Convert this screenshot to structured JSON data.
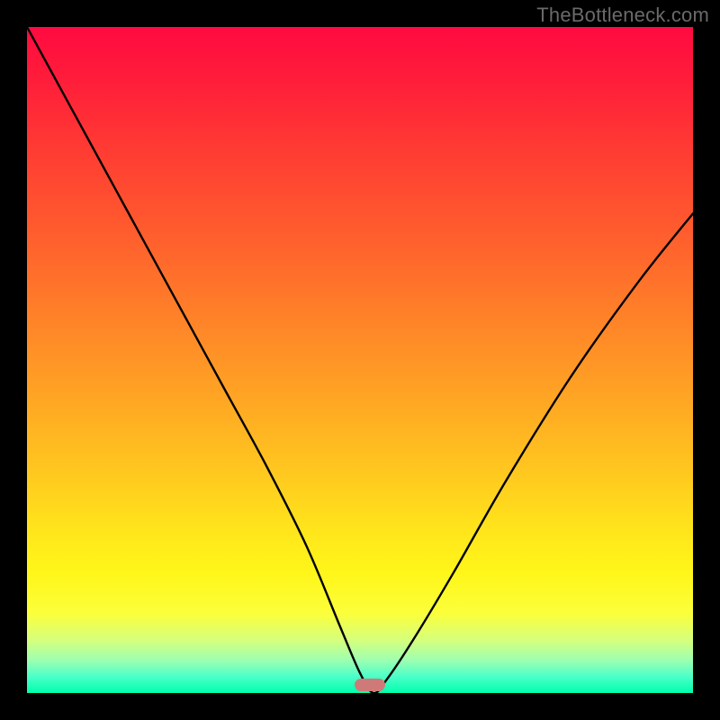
{
  "watermark": "TheBottleneck.com",
  "chart_data": {
    "type": "line",
    "title": "",
    "xlabel": "",
    "ylabel": "",
    "xlim": [
      0,
      100
    ],
    "ylim": [
      0,
      100
    ],
    "grid": false,
    "legend": false,
    "background_gradient": {
      "0": "#ff0a40",
      "55": "#ffa324",
      "82": "#fff61a",
      "100": "#00ffad"
    },
    "series": [
      {
        "name": "bottleneck-curve",
        "x": [
          0,
          6,
          12,
          18,
          24,
          30,
          36,
          42,
          47,
          50,
          52,
          54,
          58,
          64,
          72,
          82,
          92,
          100
        ],
        "values": [
          100,
          89,
          78,
          67,
          56,
          45,
          34,
          22,
          10,
          3,
          0,
          2,
          8,
          18,
          32,
          48,
          62,
          72
        ]
      }
    ],
    "marker": {
      "x": 51.5,
      "y": 1.2,
      "color": "#cf7a78"
    }
  }
}
